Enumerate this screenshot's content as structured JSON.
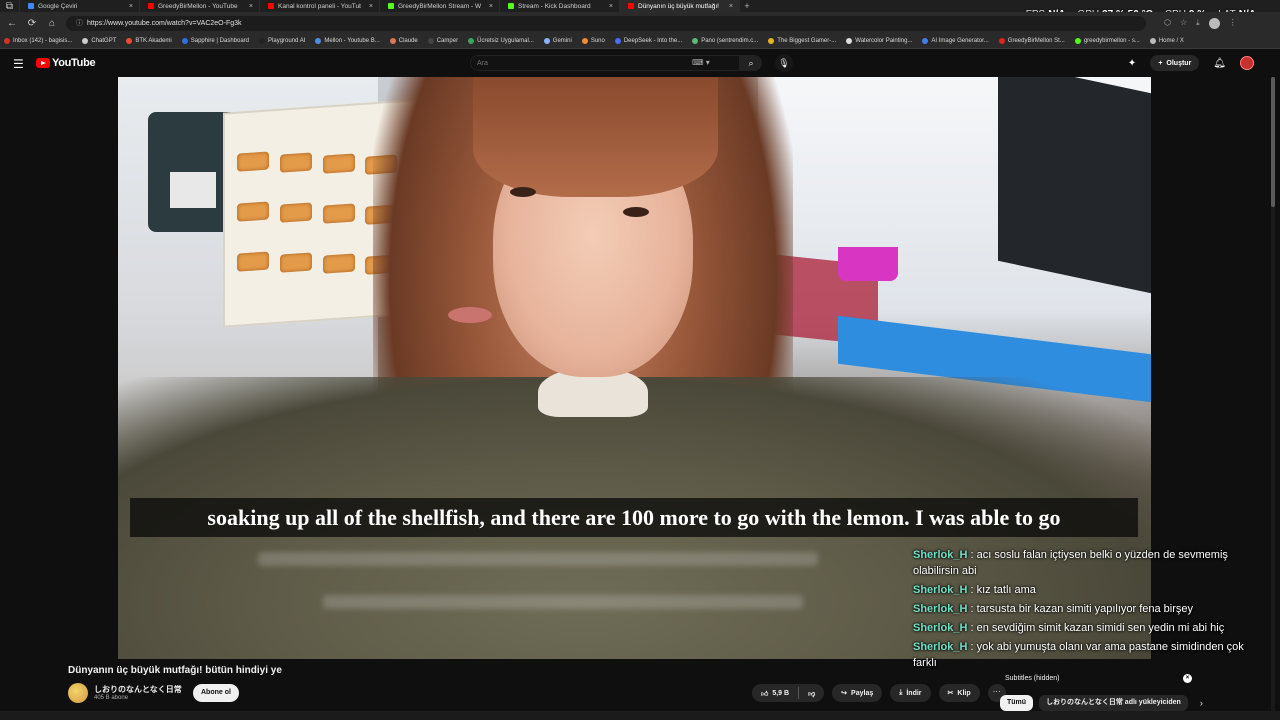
{
  "browser": {
    "tabs": [
      {
        "label": "Google Çeviri",
        "color": "#4285f4",
        "active": false
      },
      {
        "label": "GreedyBirMellon - YouTube",
        "color": "#ff0000",
        "active": false
      },
      {
        "label": "Kanal kontrol paneli - YouTube St",
        "color": "#ff0000",
        "active": false
      },
      {
        "label": "GreedyBirMellon Stream - Watch",
        "color": "#53fc18",
        "active": false
      },
      {
        "label": "Stream - Kick Dashboard",
        "color": "#53fc18",
        "active": false
      },
      {
        "label": "Dünyanın üç büyük mutfağı! bütü",
        "color": "#ff0000",
        "active": true
      }
    ],
    "url": "https://www.youtube.com/watch?v=VAC2eO-Fg3k",
    "bookmarks": [
      {
        "label": "Inbox (142) - bagisis...",
        "color": "#d93025"
      },
      {
        "label": "ChatGPT",
        "color": "#cfcfcf"
      },
      {
        "label": "BTK Akademi",
        "color": "#e94b35"
      },
      {
        "label": "Sapphire | Dashboard",
        "color": "#2f6fe0"
      },
      {
        "label": "Playground AI",
        "color": "#222222"
      },
      {
        "label": "Mellon - Youtube B...",
        "color": "#4a90e2"
      },
      {
        "label": "Claude",
        "color": "#d97757"
      },
      {
        "label": "Camper",
        "color": "#444444"
      },
      {
        "label": "Ücretsiz Uygulamal...",
        "color": "#3ba55d"
      },
      {
        "label": "Gemini",
        "color": "#8ab4f8"
      },
      {
        "label": "Suno",
        "color": "#f28b30"
      },
      {
        "label": "DeepSeek - Into the...",
        "color": "#4d6bfe"
      },
      {
        "label": "Pano (sentrendim.c...",
        "color": "#5fb878"
      },
      {
        "label": "The Biggest Gamer-...",
        "color": "#e6b422"
      },
      {
        "label": "Watercolor Painting...",
        "color": "#dddddd"
      },
      {
        "label": "AI Image Generator...",
        "color": "#3d7ef0"
      },
      {
        "label": "GreedyBirMellon St...",
        "color": "#e02424"
      },
      {
        "label": "greedybirmellon - s...",
        "color": "#53fc18"
      },
      {
        "label": "Home / X",
        "color": "#bbbbbb"
      }
    ]
  },
  "overlay": {
    "fps_label": "FPS",
    "fps_value": "N/A",
    "gpu_label": "GPU",
    "gpu_value": "37 % 50 °C",
    "cpu_label": "CPU",
    "cpu_value": "9 %",
    "lat_label": "LAT",
    "lat_value": "N/A"
  },
  "youtube": {
    "logo": "YouTube",
    "search_placeholder": "Ara",
    "create_label": "Oluştur"
  },
  "video": {
    "subtitle": "soaking up all of the shellfish, and there are 100 more to go with the lemon. I was able to go",
    "title": "Dünyanın üç büyük mutfağı! bütün hindiyi ye",
    "channel": "しおりのなんとなく日常",
    "subscribers": "405 B abone",
    "subscribe_label": "Abone ol",
    "likes": "5,9 B",
    "share_label": "Paylaş",
    "download_label": "İndir",
    "clip_label": "Klip"
  },
  "chat": [
    {
      "user": "Sherlok_H",
      "text": ": acı soslu falan içtiysen belki o yüzden de sevmemiş olabilirsin abi"
    },
    {
      "user": "Sherlok_H",
      "text": ": kız tatlı ama"
    },
    {
      "user": "Sherlok_H",
      "text": ": tarsusta bir kazan simiti yapılıyor fena birşey"
    },
    {
      "user": "Sherlok_H",
      "text": ": en sevdiğim simit kazan simidi sen yedin mi abi hiç"
    },
    {
      "user": "Sherlok_H",
      "text": ": yok abi yumuşta olanı var ama pastane simidinden çok farklı"
    }
  ],
  "side": {
    "subtitles_label": "Subtitles (hidden)",
    "chip_all": "Tümü",
    "chip_channel": "しおりのなんとなく日常 adlı yükleyiciden"
  },
  "colors": {
    "accent": "#ff0000",
    "chat_user": "#6fe0c5",
    "background": "#0f0f0f"
  }
}
